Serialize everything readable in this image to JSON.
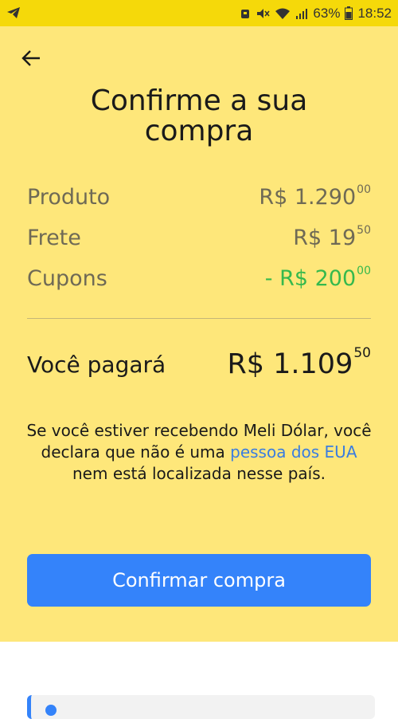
{
  "status_bar": {
    "battery_percent": "63%",
    "time": "18:52",
    "icons": [
      "telegram-icon",
      "alarm-icon",
      "mute-icon",
      "wifi-icon",
      "signal-icon",
      "battery-icon"
    ]
  },
  "header": {
    "back_icon": "arrow-left-icon",
    "title": "Confirme a sua compra"
  },
  "summary": {
    "product": {
      "label": "Produto",
      "value": "R$ 1.290",
      "cents": "00"
    },
    "shipping": {
      "label": "Frete",
      "value": "R$ 19",
      "cents": "50"
    },
    "coupons": {
      "label": "Cupons",
      "value": "- R$ 200",
      "cents": "00"
    }
  },
  "total": {
    "label": "Você pagará",
    "value": "R$ 1.109",
    "cents": "50"
  },
  "notice": {
    "text_before": "Se você estiver recebendo Meli Dólar, você declara que não é uma ",
    "link": "pessoa dos EUA",
    "text_after": " nem está localizada nesse país."
  },
  "actions": {
    "confirm_label": "Confirmar compra"
  },
  "colors": {
    "status_bar": "#f5d90a",
    "panel": "#fee77a",
    "button": "#3483fa",
    "discount": "#35b94d",
    "link": "#3a7de0"
  }
}
